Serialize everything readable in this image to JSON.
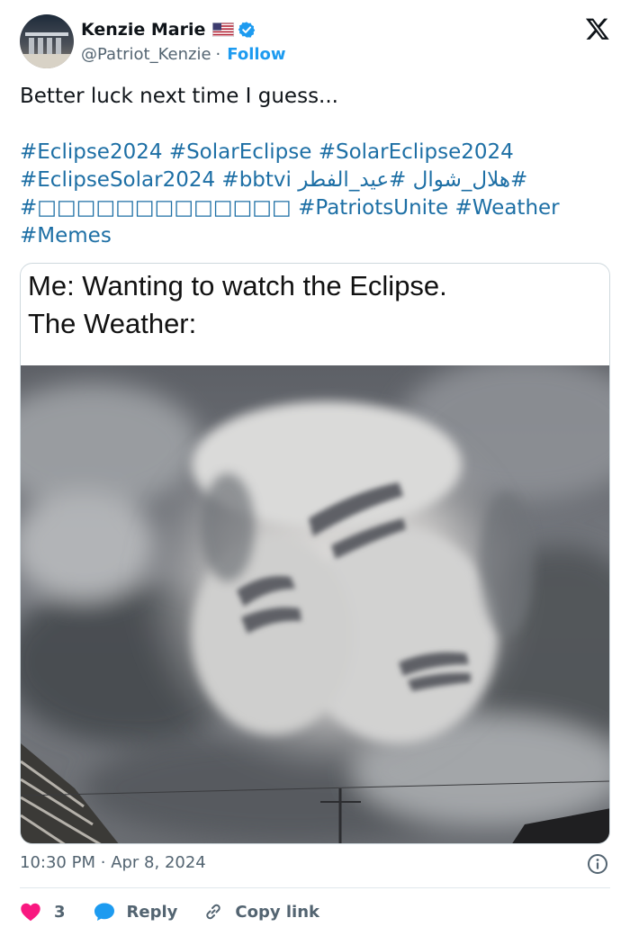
{
  "author": {
    "display_name": "Kenzie Marie",
    "handle": "@Patriot_Kenzie",
    "separator": "·",
    "follow_label": "Follow",
    "flag_icon": "us-flag-icon",
    "verified_icon": "verified-badge-icon"
  },
  "brand_icon": "x-logo-icon",
  "tweet": {
    "text": "Better luck next time I guess...",
    "hashtag_lines": [
      [
        "#Eclipse2024",
        "#SolarEclipse",
        "#SolarEclipse2024"
      ],
      [
        "#EclipseSolar2024",
        "#bbtvi",
        "#هلال_شوال",
        "#عيد_الفطر"
      ],
      [
        "#□□□□□□□□□□□□□",
        "#PatriotsUnite",
        "#Weather"
      ],
      [
        "#Memes"
      ]
    ]
  },
  "media": {
    "caption_line1": "Me: Wanting to watch the Eclipse.",
    "caption_line2": "The Weather:"
  },
  "meta": {
    "time": "10:30 PM",
    "separator": "·",
    "date": "Apr 8, 2024",
    "info_icon": "info-icon"
  },
  "actions": {
    "like_count": "3",
    "reply_label": "Reply",
    "copy_label": "Copy link"
  },
  "colors": {
    "link": "#1d6fa5",
    "follow": "#1d9bf0",
    "like": "#f91880",
    "reply_bubble": "#1d9bf0",
    "muted": "#536471"
  }
}
